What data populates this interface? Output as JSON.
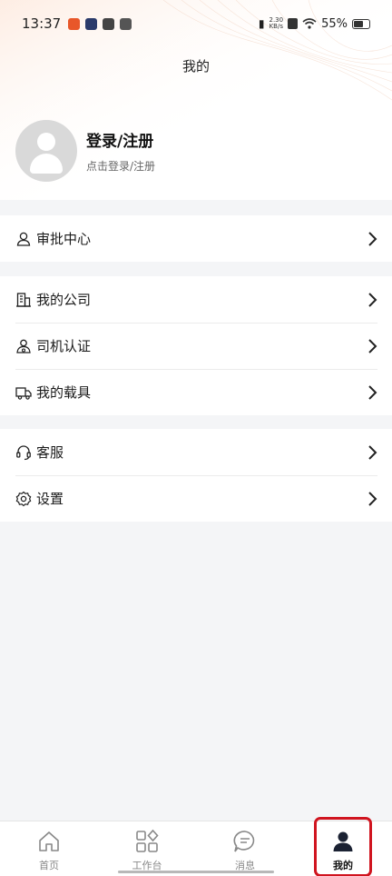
{
  "status_bar": {
    "time": "13:37",
    "network_speed_value": "2.30",
    "network_speed_unit": "KB/s",
    "battery": "55%"
  },
  "header": {
    "title": "我的"
  },
  "profile": {
    "title": "登录/注册",
    "subtitle": "点击登录/注册"
  },
  "sections": {
    "approval": [
      {
        "label": "审批中心",
        "icon": "user-check-icon"
      }
    ],
    "company": [
      {
        "label": "我的公司",
        "icon": "building-icon"
      },
      {
        "label": "司机认证",
        "icon": "driver-icon"
      },
      {
        "label": "我的载具",
        "icon": "truck-icon"
      }
    ],
    "support": [
      {
        "label": "客服",
        "icon": "headset-icon"
      },
      {
        "label": "设置",
        "icon": "gear-icon"
      }
    ]
  },
  "tabbar": {
    "tabs": [
      {
        "label": "首页",
        "icon": "home-icon"
      },
      {
        "label": "工作台",
        "icon": "workbench-icon"
      },
      {
        "label": "消息",
        "icon": "message-icon"
      },
      {
        "label": "我的",
        "icon": "profile-icon",
        "active": true
      }
    ]
  },
  "colors": {
    "accent": "#111111",
    "highlight": "#d0141f",
    "background": "#f4f5f7"
  }
}
